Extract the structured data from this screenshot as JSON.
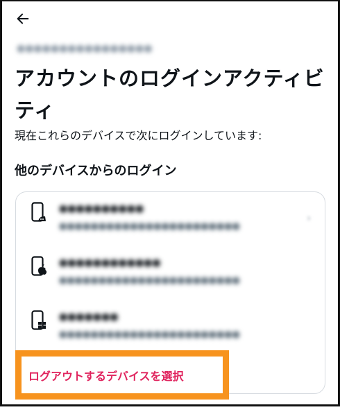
{
  "header": {
    "back_icon": "arrow-left-icon",
    "account_handle": "●●●●●●●●●●●●●●●●"
  },
  "page": {
    "title": "アカウントのログインアクティビティ",
    "subtitle": "現在これらのデバイスで次にログインしています:",
    "section_heading": "他のデバイスからのログイン"
  },
  "devices": [
    {
      "icon": "android-phone-icon",
      "name": "●●●●●●●●●●",
      "meta": "●●●●●●●●●●●●●●●●●●●●●●●"
    },
    {
      "icon": "apple-device-icon",
      "name": "●●●●●●●●●●●●",
      "meta": "●●●●●●●●●●●●●●●●●●●●●●●"
    },
    {
      "icon": "windows-device-icon",
      "name": "●●●●●●●",
      "meta": "●●●●●●●●●●●●●●●●●●●●●●●"
    }
  ],
  "actions": {
    "logout_select_label": "ログアウトするデバイスを選択"
  },
  "colors": {
    "accent_red": "#e0245e",
    "highlight_orange": "#f7931e",
    "text_primary": "#0f1419",
    "text_secondary": "#536471",
    "card_border": "#d6dbe0"
  }
}
